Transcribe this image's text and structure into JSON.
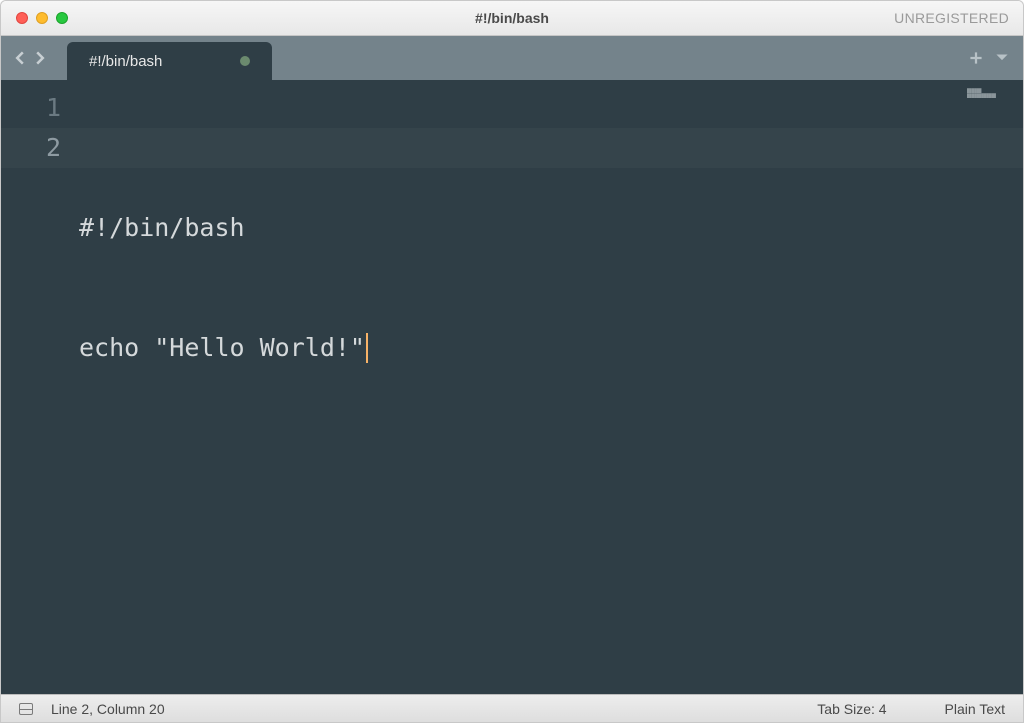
{
  "titlebar": {
    "title": "#!/bin/bash",
    "registration": "UNREGISTERED"
  },
  "tabs": {
    "active": {
      "label": "#!/bin/bash",
      "dirty": true
    }
  },
  "editor": {
    "lines": [
      {
        "num": "1",
        "text": "#!/bin/bash"
      },
      {
        "num": "2",
        "text": "echo \"Hello World!\""
      }
    ],
    "cursor_line": 2
  },
  "statusbar": {
    "position": "Line 2, Column 20",
    "tab_size": "Tab Size: 4",
    "syntax": "Plain Text"
  },
  "colors": {
    "editor_bg": "#2f3e46",
    "tabbar_bg": "#74838b",
    "text": "#d5d9db",
    "cursor": "#f7b267"
  }
}
